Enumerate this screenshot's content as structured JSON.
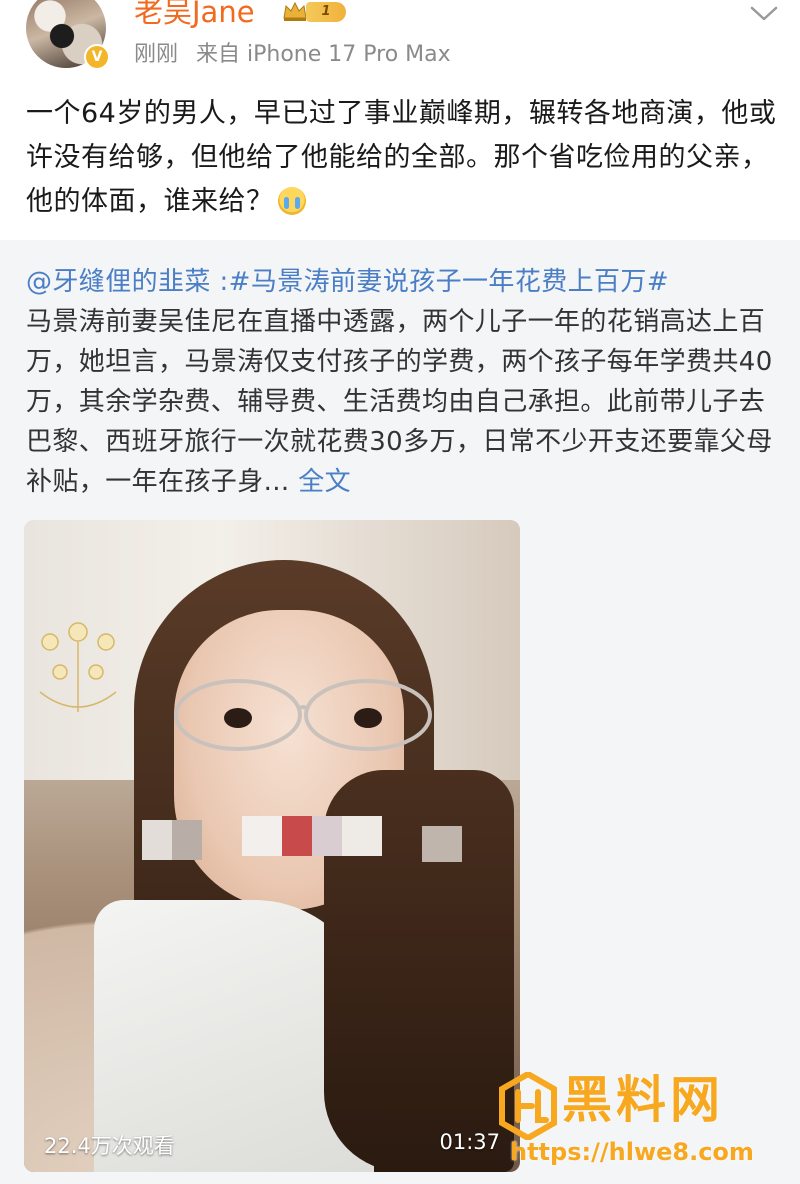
{
  "header": {
    "username": "老吴Jane",
    "level": "1",
    "time": "刚刚",
    "source": "来自 iPhone 17 Pro Max"
  },
  "post": {
    "text": "一个64岁的男人，早已过了事业巅峰期，辗转各地商演，他或许没有给够，但他给了他能给的全部。那个省吃俭用的父亲，他的体面，谁来给？",
    "emoji_icon": "cry-emoji"
  },
  "repost": {
    "mention": "@牙缝俚的韭菜",
    "separator": " :",
    "hashtag": "#马景涛前妻说孩子一年花费上百万#",
    "body": "马景涛前妻吴佳尼在直播中透露，两个儿子一年的花销高达上百万，她坦言，马景涛仅支付孩子的学费，两个孩子每年学费共40万，其余学杂费、辅导费、生活费均由自己承担。此前带儿子去巴黎、西班牙旅行一次就花费30多万，日常不少开支还要靠父母补贴，一年在孩子身...",
    "full_text_link": "全文"
  },
  "video": {
    "view_count": "22.4万次观看",
    "duration": "01:37"
  },
  "watermark": {
    "brand": "黑料网",
    "url": "https://hlwe8.com"
  },
  "colors": {
    "username": "#f26a1f",
    "link": "#4a7ec5",
    "repost_bg": "#f4f5f7",
    "watermark": "#f7a81f"
  }
}
